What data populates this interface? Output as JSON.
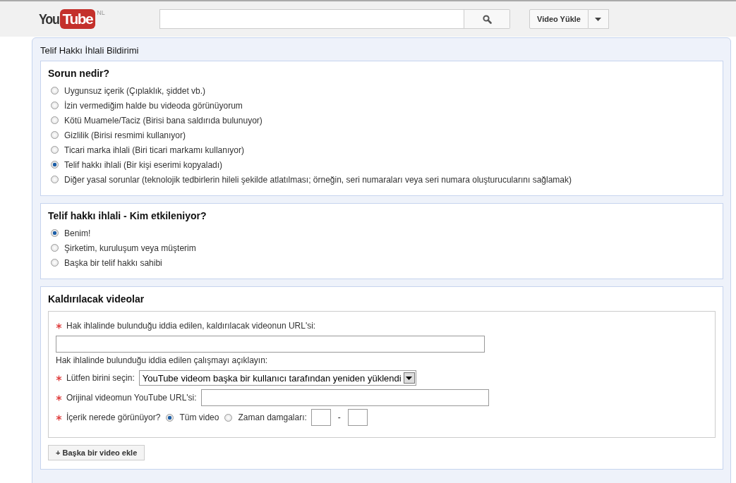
{
  "header": {
    "logo": {
      "you": "You",
      "tube": "Tube",
      "region": "NL"
    },
    "upload_button": "Video Yükle"
  },
  "form": {
    "title": "Telif Hakkı İhlali Bildirimi",
    "sections": [
      {
        "title": "Sorun nedir?",
        "options": [
          {
            "label": "Uygunsuz içerik (Çıplaklık, şiddet vb.)",
            "selected": false
          },
          {
            "label": "İzin vermediğim halde bu videoda görünüyorum",
            "selected": false
          },
          {
            "label": "Kötü Muamele/Taciz (Birisi bana saldırıda bulunuyor)",
            "selected": false
          },
          {
            "label": "Gizlilik (Birisi resmimi kullanıyor)",
            "selected": false
          },
          {
            "label": "Ticari marka ihlali (Biri ticari markamı kullanıyor)",
            "selected": false
          },
          {
            "label": "Telif hakkı ihlali (Bir kişi eserimi kopyaladı)",
            "selected": true
          },
          {
            "label": "Diğer yasal sorunlar (teknolojik tedbirlerin hileli şekilde atlatılması; örneğin, seri numaraları veya seri numara oluşturucularını sağlamak)",
            "selected": false
          }
        ]
      },
      {
        "title": "Telif hakkı ihlali - Kim etkileniyor?",
        "options": [
          {
            "label": "Benim!",
            "selected": true
          },
          {
            "label": "Şirketim, kuruluşum veya müşterim",
            "selected": false
          },
          {
            "label": "Başka bir telif hakkı sahibi",
            "selected": false
          }
        ]
      }
    ],
    "videos": {
      "title": "Kaldırılacak videolar",
      "url_label": "Hak ihlalinde bulunduğu iddia edilen, kaldırılacak videonun URL'si:",
      "describe_label": "Hak ihlalinde bulunduğu iddia edilen çalışmayı açıklayın:",
      "select_label": "Lütfen birini seçin:",
      "select_value": "YouTube videom başka bir kullanıcı tarafından yeniden yüklendi",
      "original_label": "Orijinal videomun YouTube URL'si:",
      "where_label": "İçerik nerede görünüyor?",
      "where_options": [
        {
          "label": "Tüm video",
          "selected": true
        },
        {
          "label": "Zaman damgaları:",
          "selected": false
        }
      ],
      "range_separator": "-",
      "add_button": "+ Başka bir video ekle"
    }
  }
}
